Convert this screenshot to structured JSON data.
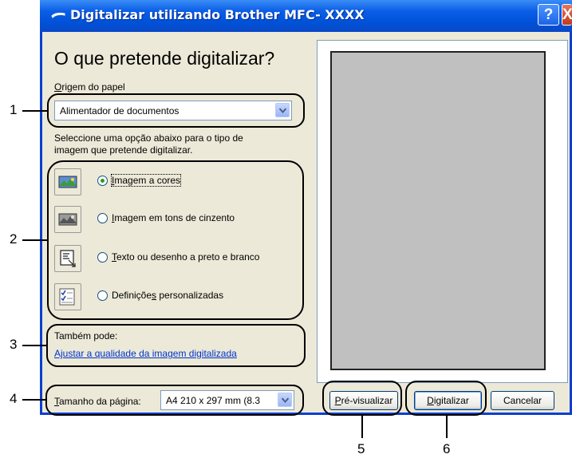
{
  "window": {
    "title": "Digitalizar utilizando Brother MFC- XXXX",
    "help_label": "?",
    "close_label": "X"
  },
  "main": {
    "heading": "O que pretende digitalizar?",
    "paper_source_label_first": "O",
    "paper_source_label_rest": "rigem do papel",
    "paper_source_value": "Alimentador de documentos",
    "instructions_line1": "Seleccione uma opção abaixo para o tipo de",
    "instructions_line2": "imagem que pretende digitalizar.",
    "options": [
      {
        "pre": "",
        "key": "I",
        "post": "magem a cores",
        "checked": true,
        "icon": "color-image-icon"
      },
      {
        "pre": "",
        "key": "I",
        "post": "magem em tons de cinzento",
        "checked": false,
        "icon": "grayscale-image-icon"
      },
      {
        "pre": "",
        "key": "T",
        "post": "exto ou desenho a preto e branco",
        "checked": false,
        "icon": "text-drawing-icon"
      },
      {
        "pre": "Definiçõe",
        "key": "s",
        "post": " personalizadas",
        "checked": false,
        "icon": "custom-settings-icon"
      }
    ],
    "also_label": "Também pode:",
    "adjust_link": "Ajustar a qualidade da imagem digitalizada",
    "page_size_label_first": "T",
    "page_size_label_rest": "amanho da página:",
    "page_size_value": "A4 210 x 297 mm (8.3"
  },
  "buttons": {
    "preview_first": "P",
    "preview_rest": "ré-visualizar",
    "scan_first": "D",
    "scan_rest": "igitalizar",
    "cancel": "Cancelar"
  },
  "callouts": [
    "1",
    "2",
    "3",
    "4",
    "5",
    "6"
  ]
}
